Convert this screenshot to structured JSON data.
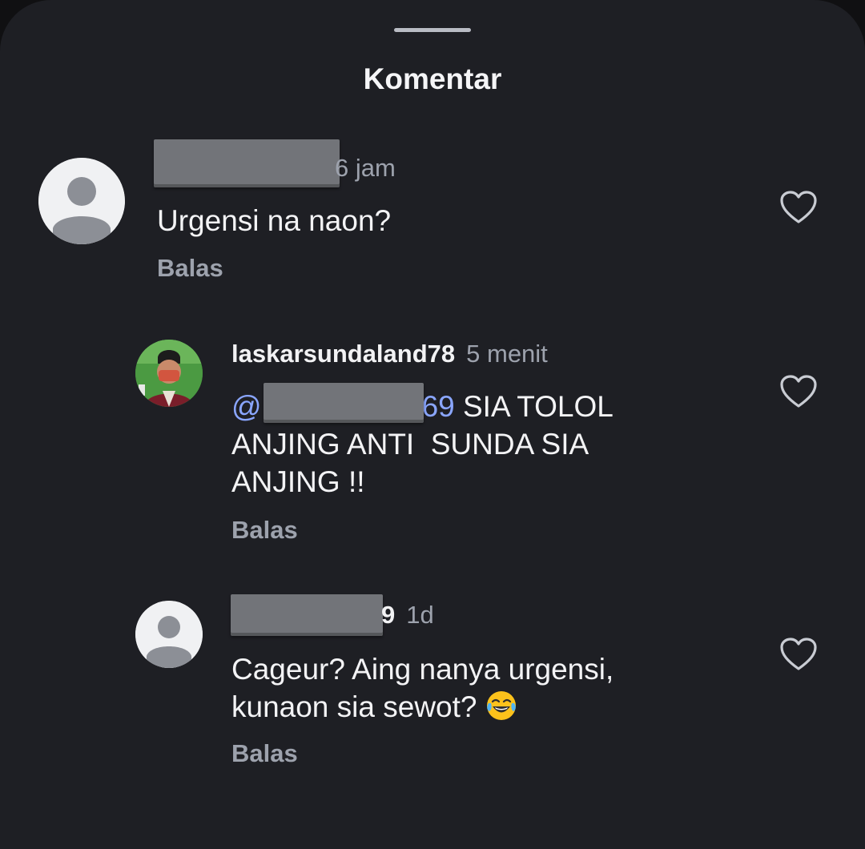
{
  "sheet": {
    "title": "Komentar"
  },
  "comments": [
    {
      "username": "",
      "username_suffix": "6 jam",
      "timestamp": "",
      "text": "Urgensi na naon?",
      "reply_label": "Balas",
      "avatar": "default-avatar-icon"
    },
    {
      "username": "laskarsundaland78",
      "timestamp": "5 menit",
      "mention_prefix": "@",
      "mention_suffix": "69",
      "text": " SIA TOLOL\nANJING ANTI  SUNDA SIA\nANJING !!",
      "reply_label": "Balas",
      "avatar": "profile-photo"
    },
    {
      "username_suffix": "9",
      "timestamp": "1d",
      "text_line1": "Cageur? Aing nanya urgensi,",
      "text_line2": "kunaon sia sewot? ",
      "emoji": "face-with-tears-of-joy",
      "reply_label": "Balas",
      "avatar": "default-avatar-icon"
    }
  ],
  "colors": {
    "background": "#1e1f24",
    "text": "#f3f3f5",
    "muted": "#9da2ad",
    "mention": "#8aa6ff",
    "redaction": "#727479"
  }
}
